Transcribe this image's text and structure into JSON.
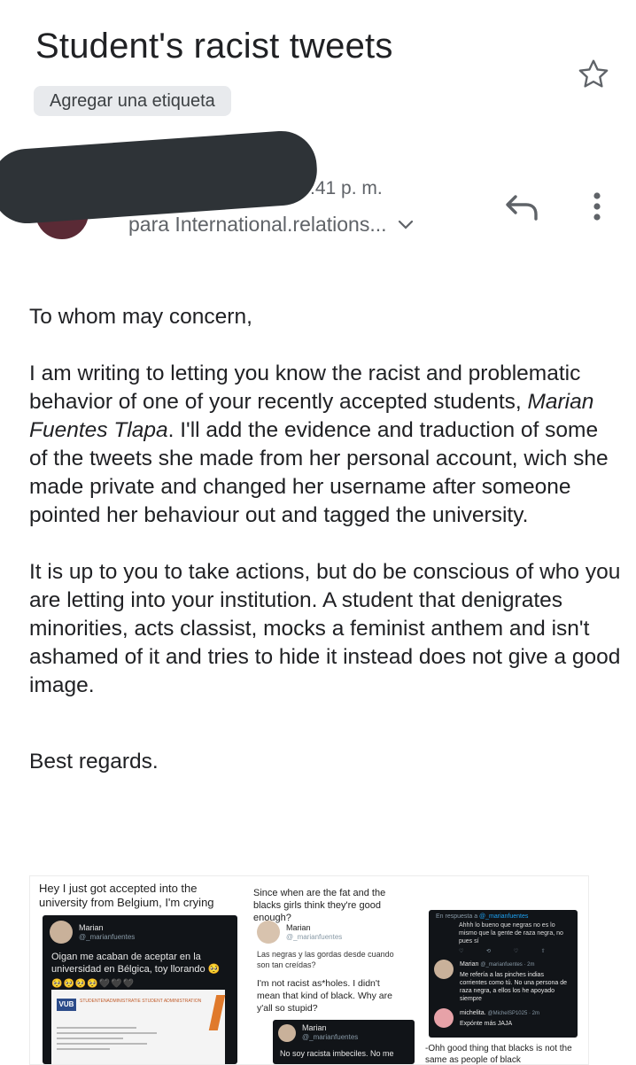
{
  "email": {
    "subject": "Student's racist tweets",
    "label_chip": "Agregar una etiqueta",
    "time": ":41 p. m.",
    "to": "para International.relations...",
    "body": {
      "greeting": "To whom may concern,",
      "para1_a": "I am writing to letting you know the racist and problematic behavior of one of your recently accepted students, ",
      "para1_name": "Marian Fuentes Tlapa",
      "para1_b": ". I'll add the evidence and traduction of some of the tweets she made from her personal account, wich she made private and changed her username after someone pointed her behaviour out and tagged the university.",
      "para2": "It is up to you to take actions, but do be conscious of who you are letting into your institution. A student that denigrates minorities, acts classist, mocks a feminist anthem and isn't ashamed of it and tries to hide it instead does not give a good image.",
      "closing": "Best regards."
    }
  },
  "icons": {
    "star": "star-icon",
    "reply": "reply-icon",
    "more": "more-vert-icon",
    "expand": "chevron-down-icon"
  },
  "colors": {
    "redaction": "#2e3337",
    "chip_bg": "#e8eaed",
    "secondary_text": "#5f6368"
  },
  "attachment": {
    "panel1": {
      "caption": "Hey I just got accepted into the university from Belgium, I'm crying",
      "tweet_name": "Marian",
      "tweet_handle": "@_marianfuentes",
      "tweet_text": "Oigan me acaban de aceptar en la universidad en Bélgica, toy llorando 🥺",
      "emoji": "🥺🥺🥺🥺🖤🖤🖤",
      "doc_logo": "VUB",
      "doc_header": "STUDENTENADMINISTRATIE STUDENT ADMINISTRATION"
    },
    "panel2": {
      "caption": "Since when are the fat and the blacks girls think they're good enough?",
      "tweet_name": "Marian",
      "tweet_handle": "@_marianfuentes",
      "tweet_text": "Las negras y las gordas desde cuando son tan creídas?",
      "note": "I'm not racist as*holes. I didn't mean that kind of black. Why are y'all so stupid?",
      "dark_name": "Marian",
      "dark_handle": "@_marianfuentes",
      "dark_text": "No soy racista imbeciles. No me"
    },
    "panel3": {
      "reply_prefix": "En respuesta a ",
      "reply_handle": "@_marianfuentes",
      "text1": "Ahhh lo bueno que negras no es lo mismo que la gente de raza negra, no pues sí",
      "name2": "Marian",
      "handle2": "@_marianfuentes · 2m",
      "text2": "Me refería a las pinches indias corrientes como tú. No una persona de raza negra, a ellos los he apoyado siempre",
      "name3": "michelita.",
      "handle3": "@MichelSP1025 · 2m",
      "text3": "Expóntе más JAJA",
      "caption": "-Ohh good thing that blacks is not the same as people of black"
    }
  }
}
